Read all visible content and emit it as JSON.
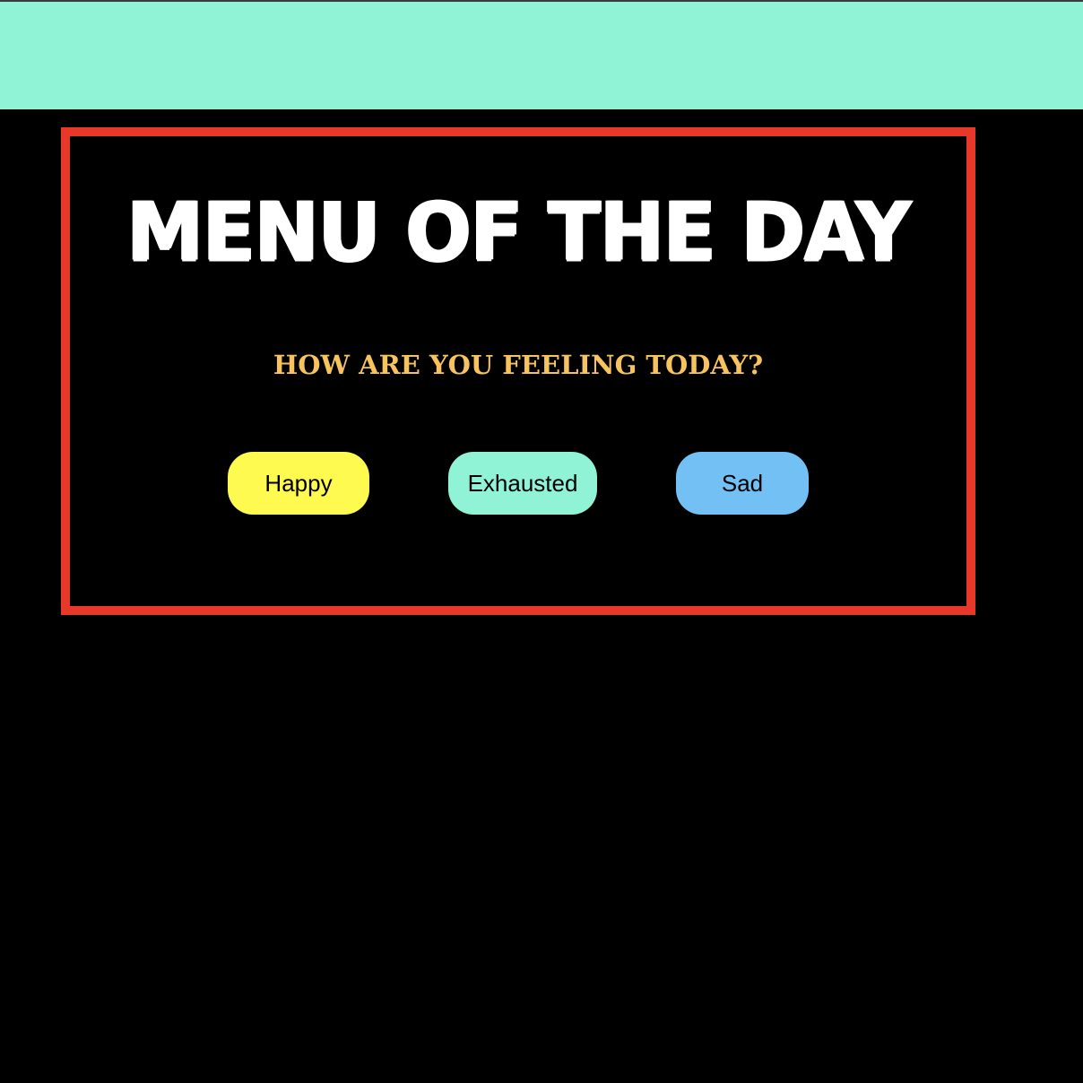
{
  "banner": {
    "color": "#90f3d6"
  },
  "card": {
    "border_color": "#e8382a",
    "title": "MENU OF THE DAY",
    "question": "HOW ARE YOU FEELING TODAY?",
    "question_color": "#f6c35e"
  },
  "moods": [
    {
      "label": "Happy",
      "color": "#fefa50"
    },
    {
      "label": "Exhausted",
      "color": "#90f3d6"
    },
    {
      "label": "Sad",
      "color": "#72c0f4"
    }
  ]
}
